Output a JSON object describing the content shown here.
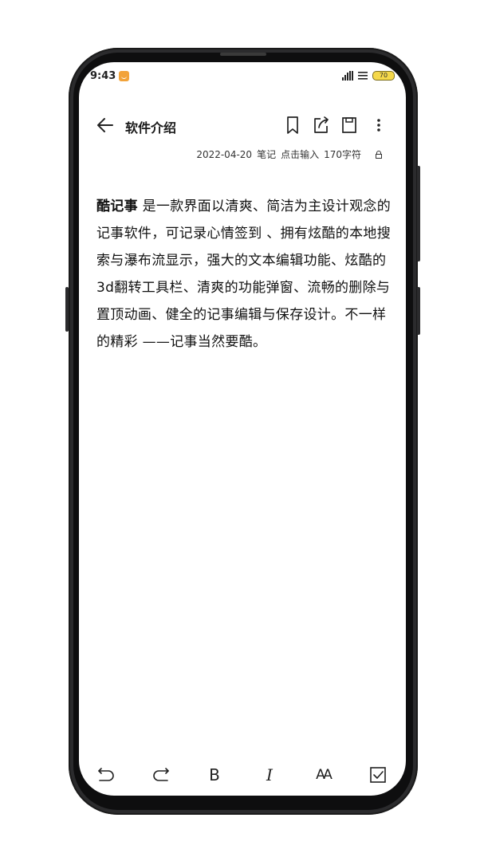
{
  "status_bar": {
    "time": "9:43",
    "battery": "70",
    "icons": [
      "app-notification-icon",
      "signal-icon",
      "wifi-icon",
      "battery-icon"
    ]
  },
  "header": {
    "title": "软件介绍",
    "icons": [
      "back-arrow-icon",
      "bookmark-icon",
      "share-icon",
      "save-icon",
      "more-vertical-icon"
    ]
  },
  "meta": {
    "date": "2022-04-20",
    "category": "笔记",
    "input_hint": "点击输入",
    "char_count": "170字符"
  },
  "note": {
    "bold_lead": "酷记事",
    "body": " 是一款界面以清爽、简洁为主设计观念的记事软件，可记录心情签到 、拥有炫酷的本地搜索与瀑布流显示，强大的文本编辑功能、炫酷的3d翻转工具栏、清爽的功能弹窗、流畅的删除与置顶动画、健全的记事编辑与保存设计。不一样的精彩 ——记事当然要酷。"
  },
  "toolbar": {
    "bold": "B",
    "italic": "I",
    "font_size": "AA",
    "icons": [
      "undo-icon",
      "redo-icon",
      "bold-icon",
      "italic-icon",
      "font-size-icon",
      "checkbox-icon"
    ]
  },
  "colors": {
    "notification": "#f2a33a",
    "battery": "#f5d84a",
    "text": "#111111"
  }
}
